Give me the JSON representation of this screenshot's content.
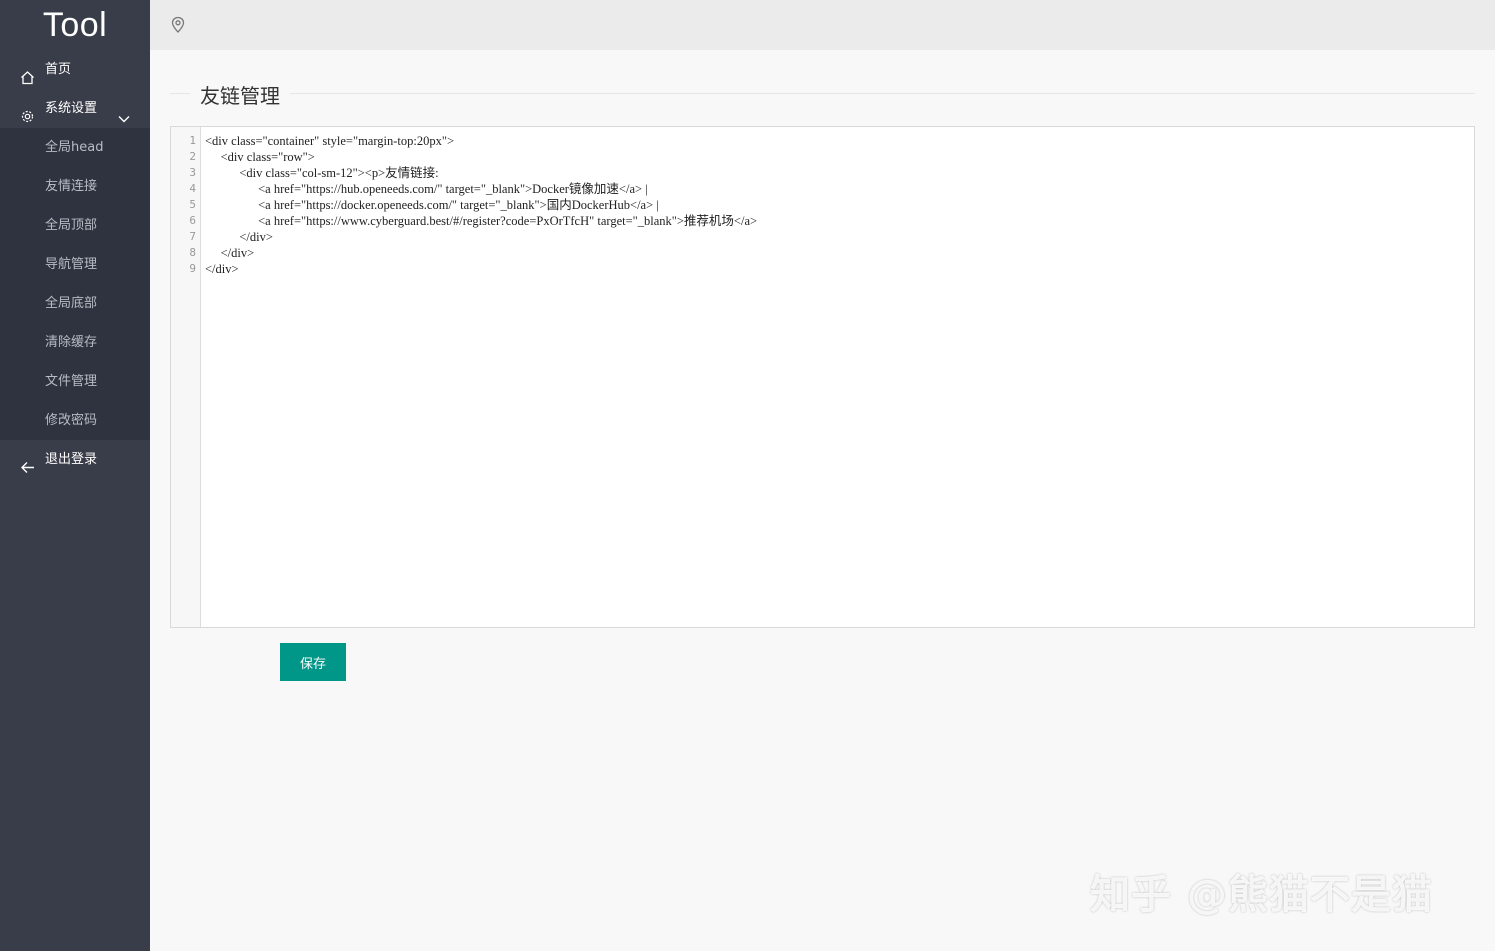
{
  "app": {
    "logo": "Tool"
  },
  "sidebar": {
    "home": {
      "label": "首页",
      "icon": "home-icon"
    },
    "settings": {
      "label": "系统设置",
      "icon": "gear-icon",
      "submenu": [
        {
          "label": "全局head"
        },
        {
          "label": "友情连接"
        },
        {
          "label": "全局顶部"
        },
        {
          "label": "导航管理"
        },
        {
          "label": "全局底部"
        },
        {
          "label": "清除缓存"
        },
        {
          "label": "文件管理"
        },
        {
          "label": "修改密码"
        }
      ]
    },
    "logout": {
      "label": "退出登录",
      "icon": "arrow-left-icon"
    }
  },
  "topbar": {
    "icon": "location-pin-icon"
  },
  "main": {
    "title": "友链管理",
    "editor": {
      "line_numbers": [
        "1",
        "2",
        "3",
        "4",
        "5",
        "6",
        "7",
        "8",
        "9"
      ],
      "lines": [
        "<div class=\"container\" style=\"margin-top:20px\">",
        "     <div class=\"row\">",
        "           <div class=\"col-sm-12\"><p>友情链接:",
        "                 <a href=\"https://hub.openeeds.com/\" target=\"_blank\">Docker镜像加速</a> |",
        "                 <a href=\"https://docker.openeeds.com/\" target=\"_blank\">国内DockerHub</a> |",
        "                 <a href=\"https://www.cyberguard.best/#/register?code=PxOrTfcH\" target=\"_blank\">推荐机场</a>",
        "           </div>",
        "     </div>",
        "</div>"
      ]
    },
    "save_label": "保存"
  },
  "watermark": "知乎 @熊猫不是猫",
  "colors": {
    "sidebar": "#393d49",
    "submenu": "#2f3340",
    "accent": "#009688"
  }
}
